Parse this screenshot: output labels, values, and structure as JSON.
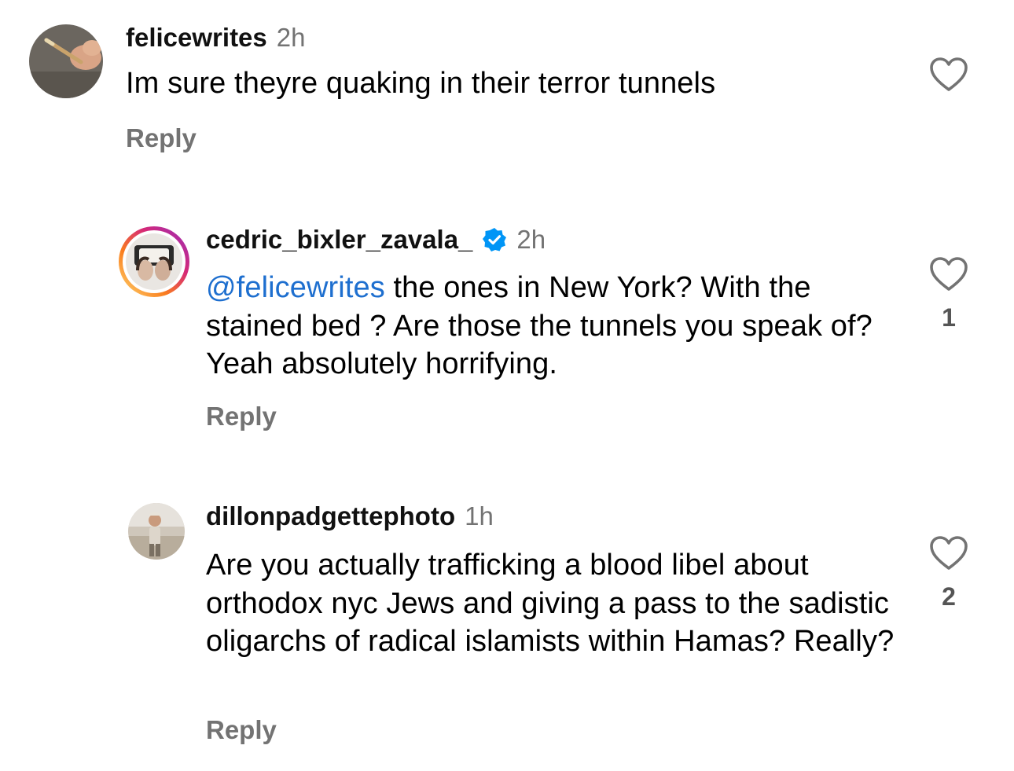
{
  "comments": [
    {
      "username": "felicewrites",
      "time": "2h",
      "text": "Im sure theyre quaking in their terror tunnels",
      "reply_label": "Reply",
      "like_count": "",
      "avatar_icon": "hand-writing-photo"
    },
    {
      "username": "cedric_bixler_zavala_",
      "verified": true,
      "time": "2h",
      "mention": "@felicewrites",
      "text": " the ones in New York? With the stained bed ? Are those the tunnels you speak of? Yeah absolutely horrifying.",
      "reply_label": "Reply",
      "like_count": "1",
      "avatar_icon": "story-ring-avatar"
    },
    {
      "username": "dillonpadgettephoto",
      "time": "1h",
      "text": "Are you actually trafficking a blood libel about orthodox nyc Jews and giving a pass to the sadistic oligarchs of radical islamists within Hamas? Really?",
      "reply_label": "Reply",
      "like_count": "2",
      "avatar_icon": "person-photo-avatar"
    }
  ],
  "colors": {
    "mention": "#1e6fcf",
    "secondary_text": "#737373",
    "verified_badge": "#0095f6"
  }
}
